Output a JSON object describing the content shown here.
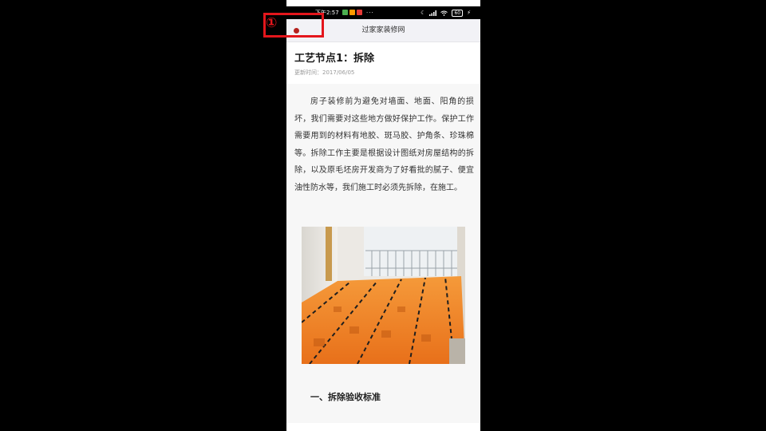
{
  "status_bar": {
    "time": "下午2:57",
    "more": "···",
    "battery": "60",
    "icons": [
      "moon-icon",
      "signal-icon",
      "wifi-icon",
      "battery-icon",
      "charging-icon"
    ]
  },
  "nav": {
    "title": "过家家装修网",
    "back_icon": "red-dot-icon"
  },
  "article": {
    "title": "工艺节点1：拆除",
    "date": "更新时间：2017/06/05",
    "paragraph": "房子装修前为避免对墙面、地面、阳角的损坏，我们需要对这些地方做好保护工作。保护工作需要用到的材料有地胶、斑马胶、护角条、珍珠棉等。拆除工作主要是根据设计图纸对房屋结构的拆除，以及原毛坯房开发商为了好看批的腻子、便宜油性防水等，我们施工时必须先拆除，在施工。",
    "section_heading": "一、拆除验收标准"
  },
  "annotation": {
    "marker": "①",
    "color": "#e4161c"
  }
}
